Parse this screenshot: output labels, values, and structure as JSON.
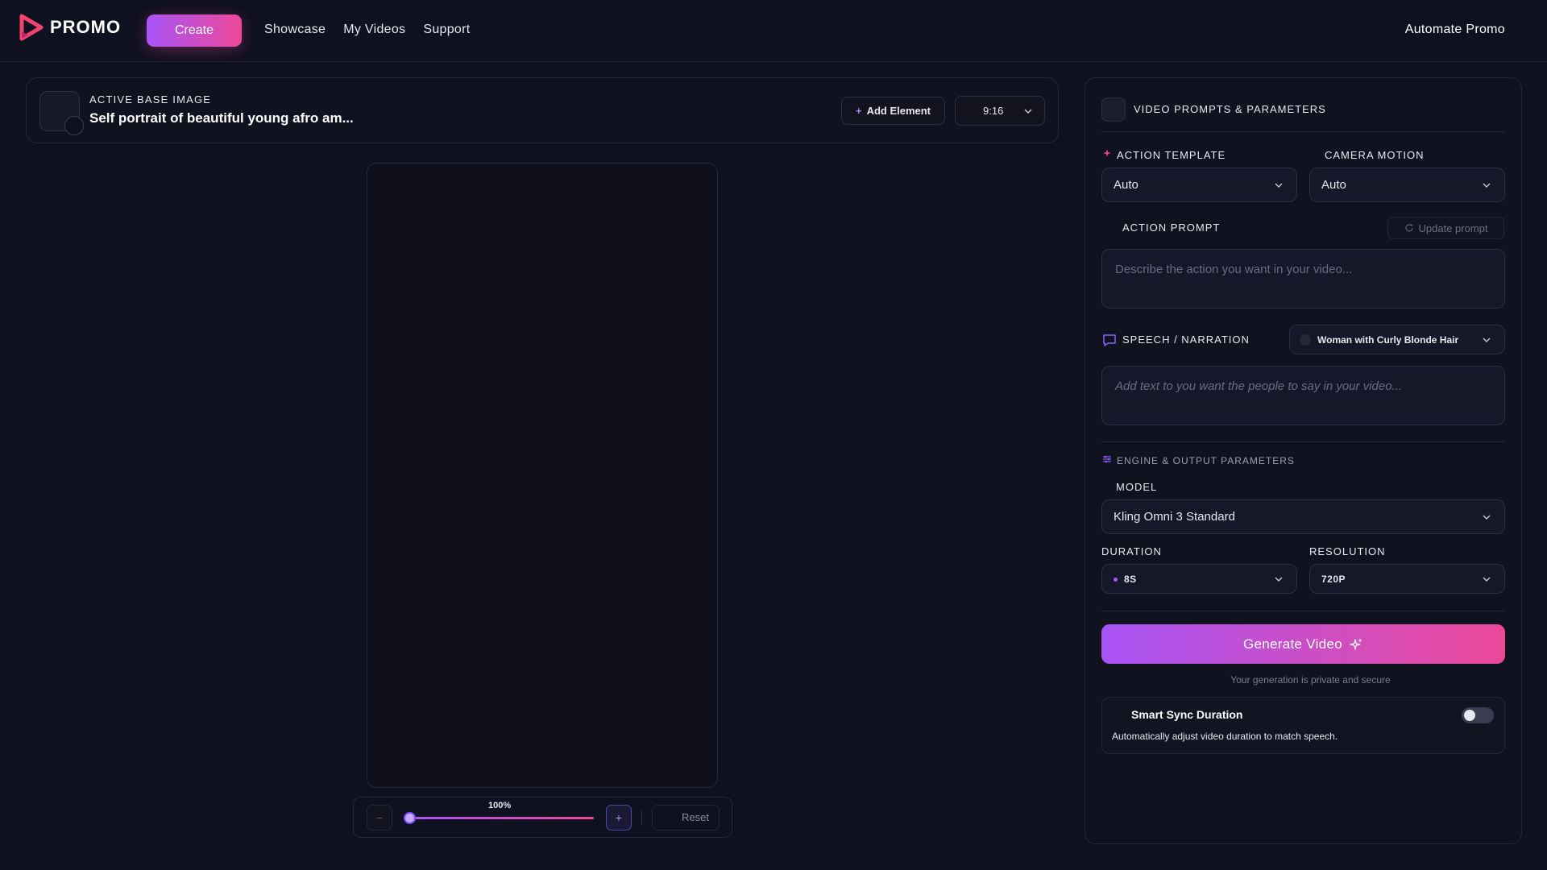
{
  "header": {
    "logo_text": "PROMO",
    "create_label": "Create",
    "nav": [
      "Showcase",
      "My Videos",
      "Support"
    ],
    "automate_label": "Automate Promo"
  },
  "base_image": {
    "label": "ACTIVE BASE IMAGE",
    "title": "Self portrait of beautiful young afro am...",
    "add_element_label": "Add Element",
    "aspect_ratio": "9:16"
  },
  "zoom": {
    "percent_label": "100%",
    "zoom_out_symbol": "−",
    "zoom_in_symbol": "+",
    "reset_label": "Reset"
  },
  "panel": {
    "heading": "VIDEO PROMPTS & PARAMETERS",
    "action_template_label": "ACTION TEMPLATE",
    "action_template_value": "Auto",
    "camera_motion_label": "CAMERA MOTION",
    "camera_motion_value": "Auto",
    "action_prompt_label": "ACTION PROMPT",
    "update_prompt_label": "Update prompt",
    "action_prompt_placeholder": "Describe the action you want in your video...",
    "speech_label": "SPEECH / NARRATION",
    "voice_value": "Woman with Curly Blonde Hair",
    "speech_placeholder": "Add text to you want the people to say in your video...",
    "engine_label": "ENGINE & OUTPUT PARAMETERS",
    "model_label": "MODEL",
    "model_value": "Kling Omni 3 Standard",
    "duration_label": "DURATION",
    "duration_value": "8S",
    "resolution_label": "RESOLUTION",
    "resolution_value": "720P",
    "generate_label": "Generate Video",
    "private_note": "Your generation is private and secure",
    "smart_sync_title": "Smart Sync Duration",
    "smart_sync_desc": "Automatically adjust video duration to match speech."
  },
  "colors": {
    "background": "#0f1020",
    "accent_start": "#a855f7",
    "accent_end": "#ec4899",
    "logo": "#f0446c"
  }
}
